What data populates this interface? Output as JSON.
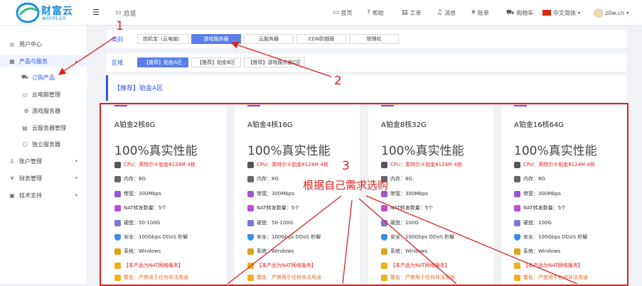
{
  "header": {
    "logo_text": "财富云",
    "logo_url": "winm.cn",
    "overview": "总览",
    "nav": [
      {
        "label": "首页",
        "icon": "monitor-icon"
      },
      {
        "label": "帮助",
        "icon": "help-icon"
      },
      {
        "label": "工单",
        "icon": "ticket-icon"
      },
      {
        "label": "消息",
        "icon": "bell-icon"
      },
      {
        "label": "账单",
        "icon": "yuan-icon"
      },
      {
        "label": "购物车",
        "icon": "cart-icon"
      }
    ],
    "language": "中文简体",
    "user": "z0w.cn"
  },
  "sidebar": {
    "items": [
      {
        "label": "用户中心",
        "icon": "user-circle-icon"
      },
      {
        "label": "产品与服务",
        "icon": "grid-icon",
        "active": true
      },
      {
        "label": "订购产品",
        "icon": "cart-icon"
      },
      {
        "label": "云电脑管理",
        "icon": "monitor-icon"
      },
      {
        "label": "游戏服务器",
        "icon": "gear-icon"
      },
      {
        "label": "云服务器管理",
        "icon": "server-icon"
      },
      {
        "label": "独立服务器",
        "icon": "box-icon"
      },
      {
        "label": "账户管理",
        "icon": "user-icon"
      },
      {
        "label": "财务管理",
        "icon": "yuan-icon"
      },
      {
        "label": "技术支持",
        "icon": "support-icon"
      }
    ]
  },
  "category": {
    "label": "类别",
    "tabs": [
      "挂机宝（云电脑）",
      "游戏服务器",
      "云服务器",
      "CDN防御盾",
      "物理机"
    ],
    "selected": 1
  },
  "region": {
    "label": "区域",
    "tabs": [
      "【推荐】铂金A区",
      "【推荐】铂金B区",
      "【推荐】游戏服务器C区"
    ],
    "selected": 0
  },
  "selected_region_title": "【推荐】铂金A区",
  "cards": [
    {
      "name": "A铂金2核8G",
      "perf": "100%真实性能",
      "cpu": "CPU：英特尔®铂金8124M 4核",
      "mem": "内存：8G",
      "bw": "带宽：300Mbps",
      "nat": "NAT转发数量：5个",
      "disk": "硬盘：50-100G",
      "sec": "安全：100Gbps DDoS 秒解",
      "os": "系统：Windows",
      "note": "【本产品为NAT网络服务】",
      "warn": "警告：严禁用于任何非法用途"
    },
    {
      "name": "A铂金4核16G",
      "perf": "100%真实性能",
      "cpu": "CPU：英特尔®铂金8124M 4核",
      "mem": "内存：8G",
      "bw": "带宽：300Mbps",
      "nat": "NAT转发数量：5个",
      "disk": "硬盘：50-100G",
      "sec": "安全：100Gbps DDoS 秒解",
      "os": "系统：Windows",
      "note": "【本产品为NAT网络服务】",
      "warn": "警告：严禁用于任何非法用途"
    },
    {
      "name": "A铂金8核32G",
      "perf": "100%真实性能",
      "cpu": "CPU：英特尔®铂金8124M 4核",
      "mem": "内存：8G",
      "bw": "带宽：300Mbps",
      "nat": "NAT转发数量：5个",
      "disk": "硬盘：100G",
      "sec": "安全：100Gbps DDoS 秒解",
      "os": "系统：Windows",
      "note": "【本产品为NAT网络服务】",
      "warn": "警告：严禁用于任何非法用途"
    },
    {
      "name": "A铂金16核64G",
      "perf": "100%真实性能",
      "cpu": "CPU：英特尔®铂金8124M 4核",
      "mem": "内存：8G",
      "bw": "带宽：300Mbps",
      "nat": "NAT转发数量：5个",
      "disk": "硬盘：100G",
      "sec": "安全：100Gbps DDoS 秒解",
      "os": "系统：Windows",
      "note": "【本产品为NAT网络服务】",
      "warn": "警告：严禁用于任何非法用途"
    }
  ],
  "annotations": {
    "step1": "1",
    "step2": "2",
    "step3": "3",
    "step3_text": "根据自己需求选购",
    "color": "#e02020"
  },
  "colors": {
    "accent": "#2f54eb",
    "tab_selected": "#5b7fe8",
    "annotation": "#e02020",
    "warning": "#e86a1a"
  }
}
